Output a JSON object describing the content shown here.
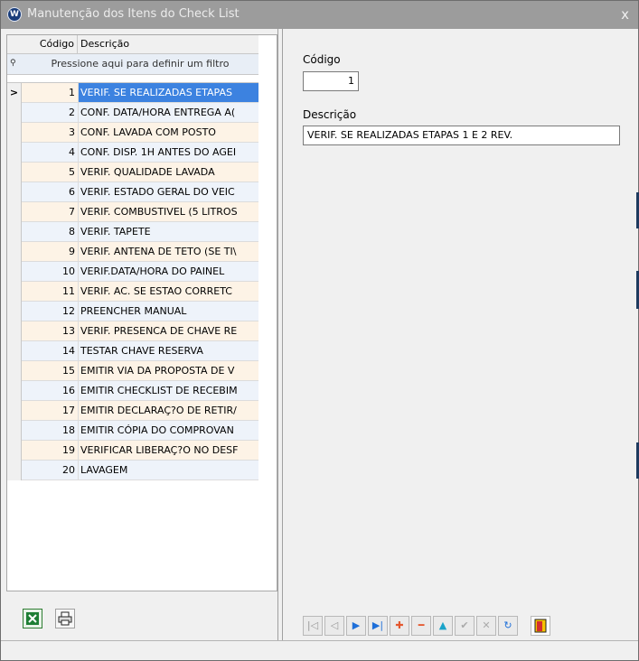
{
  "window": {
    "title": "Manutenção dos Itens do Check List",
    "title_icon": "vw-logo-icon",
    "close_label": "x"
  },
  "grid": {
    "columns": [
      "Código",
      "Descrição"
    ],
    "filter_placeholder": "Pressione aqui para definir um filtro",
    "rows": [
      {
        "code": "1",
        "desc": "VERIF. SE REALIZADAS ETAPAS",
        "indicator": ">"
      },
      {
        "code": "2",
        "desc": "CONF. DATA/HORA ENTREGA A(",
        "indicator": ""
      },
      {
        "code": "3",
        "desc": "CONF. LAVADA COM POSTO",
        "indicator": ""
      },
      {
        "code": "4",
        "desc": "CONF. DISP. 1H ANTES DO AGEI",
        "indicator": ""
      },
      {
        "code": "5",
        "desc": "VERIF. QUALIDADE LAVADA",
        "indicator": ""
      },
      {
        "code": "6",
        "desc": "VERIF. ESTADO GERAL DO VEIC",
        "indicator": ""
      },
      {
        "code": "7",
        "desc": "VERIF. COMBUSTIVEL (5 LITROS",
        "indicator": ""
      },
      {
        "code": "8",
        "desc": "VERIF. TAPETE",
        "indicator": ""
      },
      {
        "code": "9",
        "desc": "VERIF. ANTENA DE TETO (SE TI\\",
        "indicator": ""
      },
      {
        "code": "10",
        "desc": "VERIF.DATA/HORA DO PAINEL",
        "indicator": ""
      },
      {
        "code": "11",
        "desc": "VERIF. AC. SE ESTAO CORRETC",
        "indicator": ""
      },
      {
        "code": "12",
        "desc": "PREENCHER MANUAL",
        "indicator": ""
      },
      {
        "code": "13",
        "desc": "VERIF. PRESENCA DE CHAVE RE",
        "indicator": ""
      },
      {
        "code": "14",
        "desc": "TESTAR CHAVE RESERVA",
        "indicator": ""
      },
      {
        "code": "15",
        "desc": "EMITIR VIA DA PROPOSTA DE V",
        "indicator": ""
      },
      {
        "code": "16",
        "desc": "EMITIR CHECKLIST DE RECEBIM",
        "indicator": ""
      },
      {
        "code": "17",
        "desc": "EMITIR DECLARAÇ?O DE RETIR/",
        "indicator": ""
      },
      {
        "code": "18",
        "desc": "EMITIR CÓPIA DO COMPROVAN",
        "indicator": ""
      },
      {
        "code": "19",
        "desc": "VERIFICAR LIBERAÇ?O NO DESF",
        "indicator": ""
      },
      {
        "code": "20",
        "desc": "LAVAGEM",
        "indicator": ""
      }
    ]
  },
  "form": {
    "codigo_label": "Código",
    "codigo_value": "1",
    "descricao_label": "Descrição",
    "descricao_value": "VERIF. SE REALIZADAS ETAPAS 1 E 2 REV."
  },
  "toolbar": {
    "excel_icon": "excel-export-icon",
    "print_icon": "print-icon"
  },
  "navigator": {
    "first": "|◁",
    "prior": "◁",
    "next": "▶",
    "last": "▶|",
    "insert": "✚",
    "delete": "━",
    "edit": "▲",
    "post": "✔",
    "cancel": "✕",
    "refresh": "↻",
    "exit": "▮"
  },
  "colors": {
    "selected": "#3c82e0",
    "odd_row": "#fdf3e6",
    "even_row": "#eef3fa",
    "titlebar": "#9c9c9c"
  }
}
